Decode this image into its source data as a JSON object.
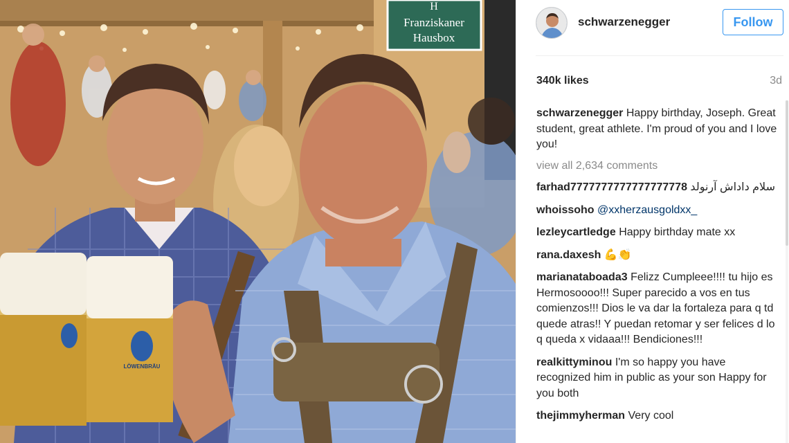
{
  "photo": {
    "sign_text_line1": "Franziskaner",
    "sign_text_line2": "Hausbox",
    "sign_text_top": "H",
    "stein_logo_text": "LÖWENBRÄU"
  },
  "header": {
    "username": "schwarzenegger",
    "follow_label": "Follow"
  },
  "post": {
    "likes": "340k likes",
    "time_ago": "3d",
    "caption": {
      "author": "schwarzenegger",
      "text": "Happy birthday, Joseph. Great student, great athlete. I'm proud of you and I love you!"
    },
    "view_all": "view all 2,634 comments",
    "comments": [
      {
        "author": "farhad7777777777777777778",
        "text": "سلام داداش آرنولد",
        "mention": ""
      },
      {
        "author": "whoissoho",
        "text": "",
        "mention": "@xxherzausgoldxx_"
      },
      {
        "author": "lezleycartledge",
        "text": "Happy birthday mate xx",
        "mention": ""
      },
      {
        "author": "rana.daxesh",
        "text": "💪👏",
        "mention": ""
      },
      {
        "author": "marianataboada3",
        "text": "Felizz Cumpleee!!!! tu hijo es Hermosoooo!!! Super parecido a vos en tus comienzos!!! Dios le va dar la fortaleza para q td quede atras!! Y puedan retomar y ser felices d lo q queda x vidaaa!!! Bendiciones!!!",
        "mention": ""
      },
      {
        "author": "realkittyminou",
        "text": "I'm so happy you have recognized him in public as your son Happy for you both",
        "mention": ""
      },
      {
        "author": "thejimmyherman",
        "text": "Very cool",
        "mention": ""
      }
    ]
  },
  "colors": {
    "accent": "#3897f0",
    "text": "#262626",
    "muted": "#8a8a8a",
    "mention": "#003569",
    "sign_green": "#2d6a56"
  }
}
